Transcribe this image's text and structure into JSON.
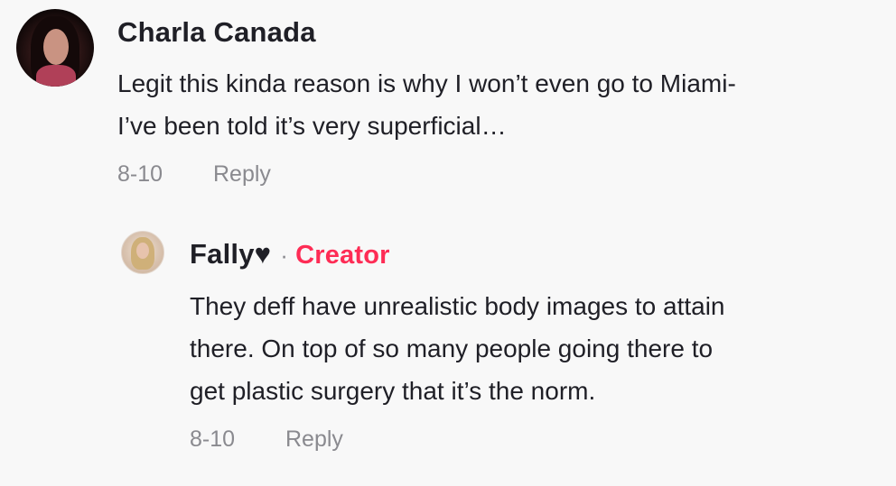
{
  "comments": [
    {
      "author": "Charla Canada",
      "text": "Legit this kinda reason is why I won’t even go to Miami-\nI’ve been told it’s very superficial…",
      "date": "8-10",
      "reply_label": "Reply",
      "avatar_icon": "user-avatar-photo"
    }
  ],
  "reply": {
    "author": "Fally♥",
    "separator": "·",
    "badge": "Creator",
    "badge_color": "#fe2c55",
    "text": "They deff have unrealistic body images to attain\nthere. On top of so many people going there to\nget plastic surgery that it’s the norm.",
    "date": "8-10",
    "reply_label": "Reply",
    "avatar_icon": "user-avatar-photo"
  }
}
